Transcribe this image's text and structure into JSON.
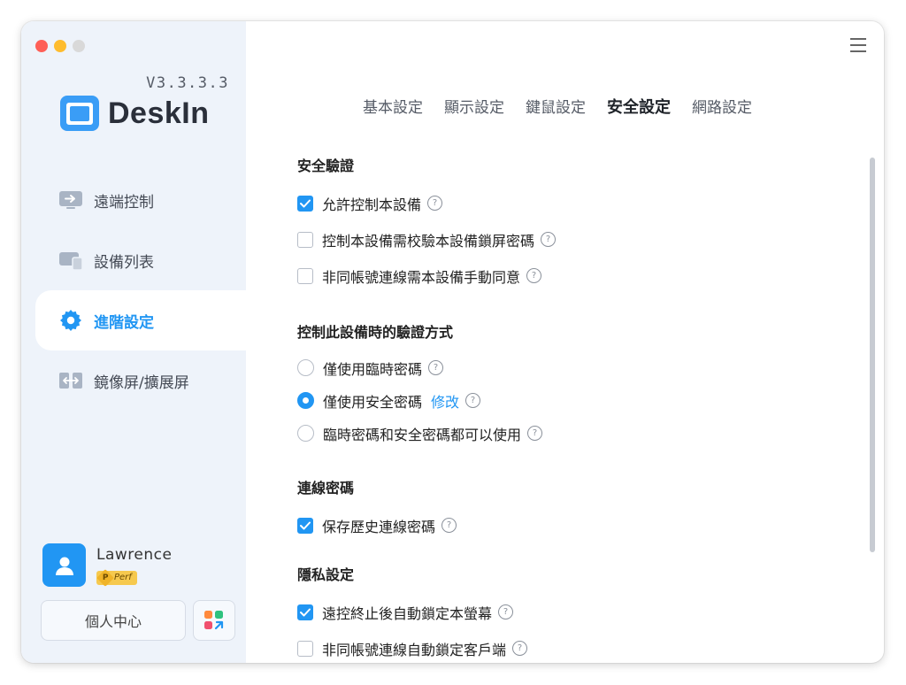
{
  "app": {
    "version": "V3.3.3.3",
    "brand_name": "DeskIn"
  },
  "sidebar": {
    "items": [
      {
        "label": "遠端控制",
        "icon": "remote-screen-icon"
      },
      {
        "label": "設備列表",
        "icon": "device-list-icon"
      },
      {
        "label": "進階設定",
        "icon": "gear-icon",
        "active": true
      },
      {
        "label": "鏡像屏/擴展屏",
        "icon": "mirror-screen-icon"
      }
    ],
    "user": {
      "name": "Lawrence",
      "badge_letter": "P",
      "badge_text": "Perf"
    },
    "center_button": "個人中心"
  },
  "tabs": [
    {
      "label": "基本設定"
    },
    {
      "label": "顯示設定"
    },
    {
      "label": "鍵鼠設定"
    },
    {
      "label": "安全設定",
      "active": true
    },
    {
      "label": "網路設定"
    }
  ],
  "security": {
    "section1_title": "安全驗證",
    "section1_options": [
      {
        "label": "允許控制本設備",
        "checked": true
      },
      {
        "label": "控制本設備需校驗本設備鎖屏密碼",
        "checked": false
      },
      {
        "label": "非同帳號連線需本設備手動同意",
        "checked": false
      }
    ],
    "section2_title": "控制此設備時的驗證方式",
    "section2_options": [
      {
        "label": "僅使用臨時密碼",
        "selected": false
      },
      {
        "label": "僅使用安全密碼",
        "selected": true,
        "link": "修改"
      },
      {
        "label": "臨時密碼和安全密碼都可以使用",
        "selected": false
      }
    ],
    "section3_title": "連線密碼",
    "section3_options": [
      {
        "label": "保存歷史連線密碼",
        "checked": true
      }
    ],
    "section4_title": "隱私設定",
    "section4_options": [
      {
        "label": "遠控終止後自動鎖定本螢幕",
        "checked": true
      },
      {
        "label": "非同帳號連線自動鎖定客戶端",
        "checked": false
      }
    ]
  },
  "colors": {
    "accent": "#2196f3",
    "sidebar_bg": "#eef3fa"
  },
  "help_glyph": "?"
}
